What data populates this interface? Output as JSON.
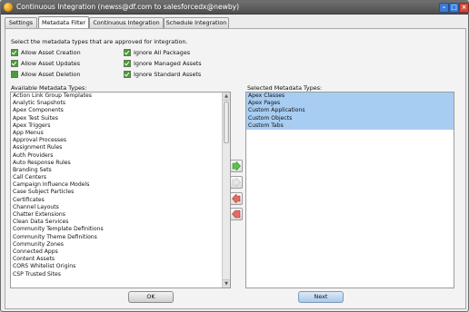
{
  "window": {
    "title": "Continuous Integration (newss@df.com to salesforcedx@newby)",
    "controls": [
      "minimize-icon",
      "maximize-icon",
      "close-icon"
    ]
  },
  "tabs": [
    {
      "label": "Settings",
      "active": false
    },
    {
      "label": "Metadata Filter",
      "active": true
    },
    {
      "label": "Continuous Integration",
      "active": false
    },
    {
      "label": "Schedule Integration",
      "active": false
    }
  ],
  "filter": {
    "intro": "Select the metadata types that are approved for integration.",
    "options": [
      {
        "label": "Allow Asset Creation",
        "checked": true
      },
      {
        "label": "Allow Asset Updates",
        "checked": true
      },
      {
        "label": "Allow Asset Deletion",
        "checked": false
      },
      {
        "label": "Ignore All Packages",
        "checked": true
      },
      {
        "label": "Ignore Managed Assets",
        "checked": true
      },
      {
        "label": "Ignore Standard Assets",
        "checked": true
      }
    ]
  },
  "available": {
    "label": "Available Metadata Types:",
    "items": [
      "Action Link Group Templates",
      "Analytic Snapshots",
      "Apex Components",
      "Apex Test Suites",
      "Apex Triggers",
      "App Menus",
      "Approval Processes",
      "Assignment Rules",
      "Auth Providers",
      "Auto Response Rules",
      "Branding Sets",
      "Call Centers",
      "Campaign Influence Models",
      "Case Subject Particles",
      "Certificates",
      "Channel Layouts",
      "Chatter Extensions",
      "Clean Data Services",
      "Community Template Definitions",
      "Community Theme Definitions",
      "Community Zones",
      "Connected Apps",
      "Content Assets",
      "CORS Whitelist Origins",
      "CSP Trusted Sites"
    ]
  },
  "selected": {
    "label": "Selected Metadata Types:",
    "items": [
      "Apex Classes",
      "Apex Pages",
      "Custom Applications",
      "Custom Objects",
      "Custom Tabs"
    ]
  },
  "transfer_buttons": [
    "add-right-icon",
    "add-all-icon",
    "remove-left-icon",
    "remove-all-icon"
  ],
  "footer": {
    "ok": "OK",
    "next": "Next"
  },
  "colors": {
    "selection": "#a8cdf2",
    "checkbox": "#4f9a3c",
    "arrow_green": "#5cc24a",
    "arrow_red": "#e26b62"
  }
}
